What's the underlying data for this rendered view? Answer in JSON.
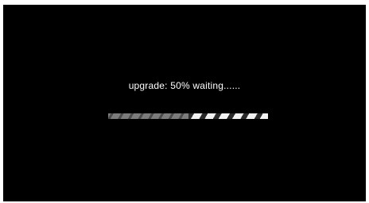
{
  "status": {
    "text": "upgrade: 50% waiting......"
  },
  "progress": {
    "fraction": 0.5
  },
  "colors": {
    "background": "#000000",
    "text": "#ffffff",
    "bar_done": "#7c7c7c",
    "bar_remaining": "#f2f2f2"
  }
}
